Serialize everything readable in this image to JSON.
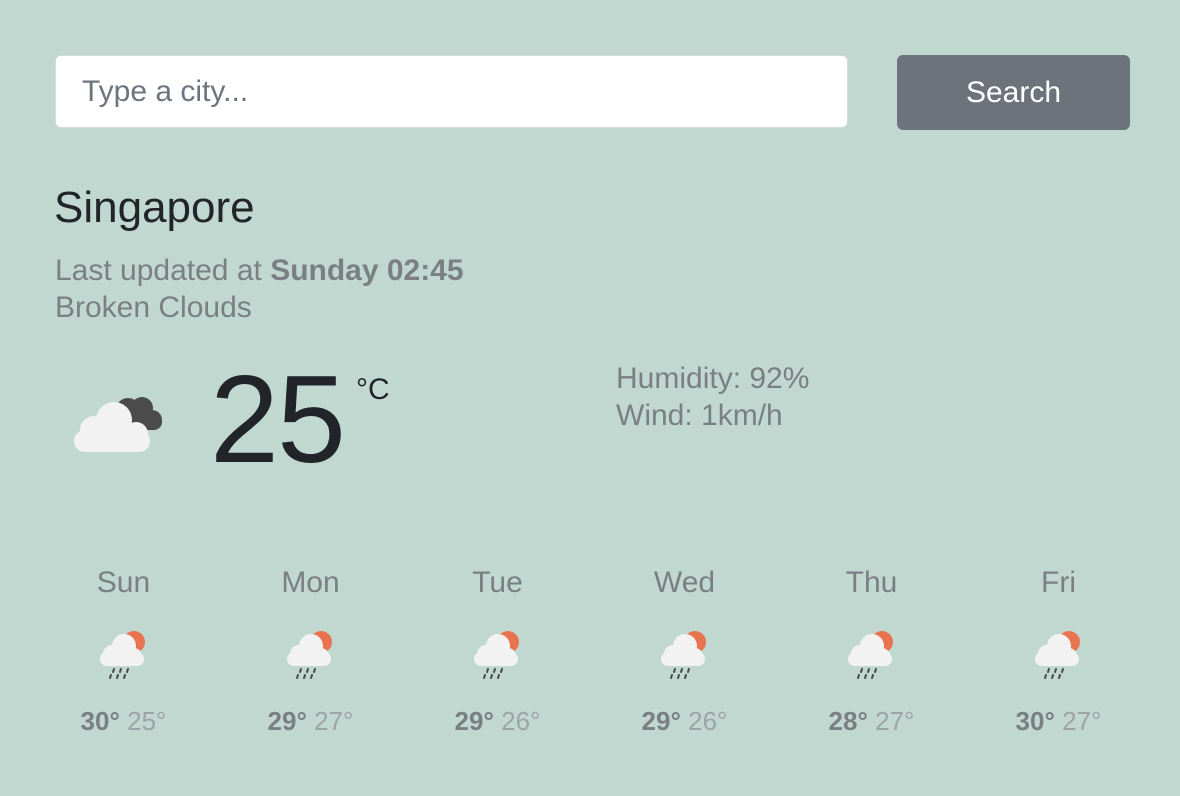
{
  "search": {
    "placeholder": "Type a city...",
    "value": "",
    "button_label": "Search"
  },
  "weather": {
    "city": "Singapore",
    "updated_prefix": "Last updated at",
    "updated_time": "Sunday 02:45",
    "description": "Broken Clouds",
    "temperature": "25",
    "unit": "°C",
    "icon": "broken-clouds-icon",
    "humidity_label": "Humidity:",
    "humidity_value": "92%",
    "wind_label": "Wind:",
    "wind_value": "1km/h"
  },
  "forecast": [
    {
      "day": "Sun",
      "max": "30°",
      "min": "25°",
      "icon": "rain-sun-icon"
    },
    {
      "day": "Mon",
      "max": "29°",
      "min": "27°",
      "icon": "rain-sun-icon"
    },
    {
      "day": "Tue",
      "max": "29°",
      "min": "26°",
      "icon": "rain-sun-icon"
    },
    {
      "day": "Wed",
      "max": "29°",
      "min": "26°",
      "icon": "rain-sun-icon"
    },
    {
      "day": "Thu",
      "max": "28°",
      "min": "27°",
      "icon": "rain-sun-icon"
    },
    {
      "day": "Fri",
      "max": "30°",
      "min": "27°",
      "icon": "rain-sun-icon"
    }
  ],
  "colors": {
    "background": "#c1d8d1",
    "button": "#6c737b",
    "sun": "#e8734f",
    "cloud_light": "#f2f2f2",
    "cloud_dark": "#4b4b4b"
  }
}
